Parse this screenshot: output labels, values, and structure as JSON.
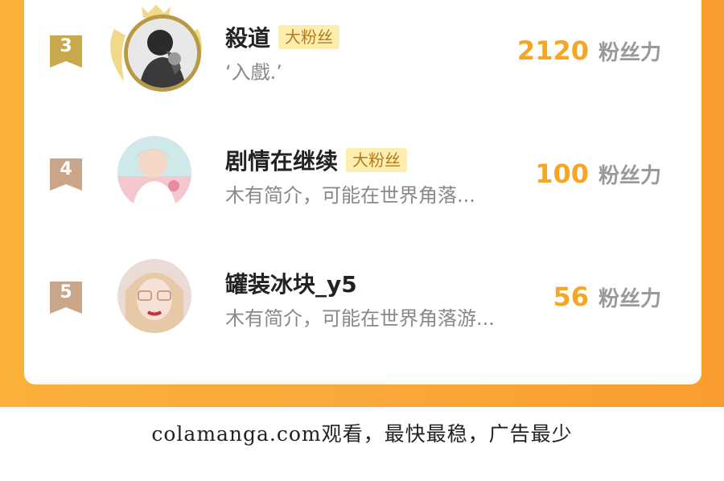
{
  "colors": {
    "orange_background": "#f9a93a",
    "card": "#ffffff",
    "rank_gold": "#c9a84e",
    "rank_bronze": "#c9a58a",
    "badge_bg": "#fdeeb0",
    "badge_text": "#b57a1a",
    "score": "#f5a623",
    "score_unit": "#999999"
  },
  "ranking": {
    "entries": [
      {
        "rank": "3",
        "name": "殺道",
        "badge": "大粉丝",
        "bio": "‘入戲.’",
        "score": "2120",
        "score_unit": "粉丝力",
        "avatar": "avatar-image",
        "rank_icon": "rank-ribbon-icon"
      },
      {
        "rank": "4",
        "name": "剧情在继续",
        "badge": "大粉丝",
        "bio": "木有简介，可能在世界角落...",
        "score": "100",
        "score_unit": "粉丝力",
        "avatar": "avatar-image",
        "rank_icon": "rank-ribbon-icon"
      },
      {
        "rank": "5",
        "name": "罐装冰块_y5",
        "badge": "",
        "bio": "木有简介，可能在世界角落游...",
        "score": "56",
        "score_unit": "粉丝力",
        "avatar": "avatar-image",
        "rank_icon": "rank-ribbon-icon"
      }
    ]
  },
  "footer": {
    "text": "colamanga.com观看，最快最稳，广告最少"
  }
}
